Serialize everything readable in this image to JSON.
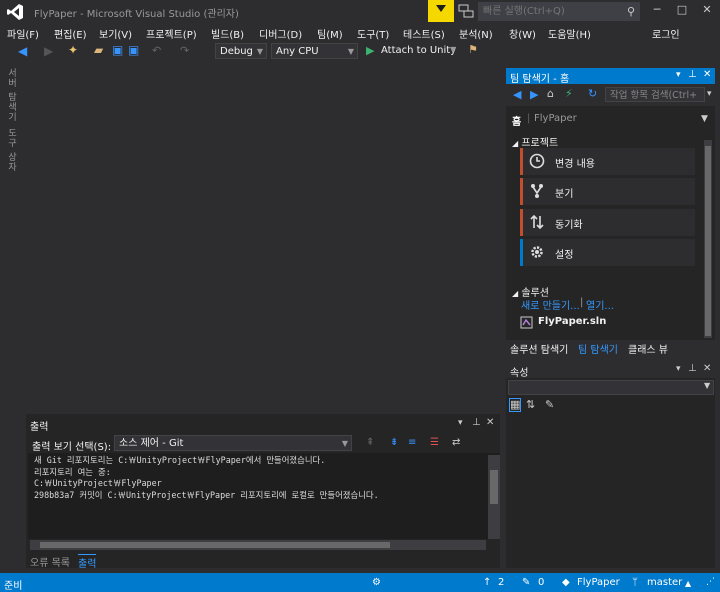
{
  "title": "FlyPaper - Microsoft Visual Studio (관리자)",
  "quick_launch": {
    "placeholder": "빠른 실행(Ctrl+Q)"
  },
  "menu": [
    "파일(F)",
    "편집(E)",
    "보기(V)",
    "프로젝트(P)",
    "빌드(B)",
    "디버그(D)",
    "팀(M)",
    "도구(T)",
    "테스트(S)",
    "분석(N)",
    "창(W)",
    "도움말(H)"
  ],
  "login": "로그인",
  "toolbar": {
    "config": "Debug",
    "platform": "Any CPU",
    "run": "Attach to Unity"
  },
  "left_tabs": [
    "서버 탐색기",
    "도구 상자"
  ],
  "team": {
    "title": "팀 탐색기 - 홈",
    "search_placeholder": "작업 항목 검색(Ctrl+",
    "home": "홈",
    "home_sub": "FlyPaper",
    "project_header": "프로젝트",
    "tiles": [
      {
        "label": "변경 내용",
        "icon": "clock-icon"
      },
      {
        "label": "분기",
        "icon": "branch-icon"
      },
      {
        "label": "동기화",
        "icon": "sync-icon"
      },
      {
        "label": "설정",
        "icon": "gear-icon"
      }
    ],
    "solution_header": "솔루션",
    "new_link": "새로 만들기...",
    "sep": "|",
    "open_link": "열기...",
    "solution_file": "FlyPaper.sln"
  },
  "right_tabs": [
    "솔루션 탐색기",
    "팀 탐색기",
    "클래스 뷰"
  ],
  "properties": {
    "title": "속성"
  },
  "output": {
    "title": "출력",
    "source_label": "출력 보기 선택(S):",
    "source_value": "소스 제어 - Git",
    "lines": [
      "새 Git 리포지토리는 C:￦UnityProject￦FlyPaper에서 만들어졌습니다.",
      "리포지토리 여는 중:",
      "C:￦UnityProject￦FlyPaper",
      "298b83a7 커밋이 C:￦UnityProject￦FlyPaper 리포지토리에 로컬로 만들어졌습니다."
    ]
  },
  "bottom_tabs": [
    "오류 목록",
    "출력"
  ],
  "status": {
    "ready": "준비",
    "up": "2",
    "pencil": "0",
    "repo": "FlyPaper",
    "branch": "master"
  },
  "colors": {
    "accent": "#007acc",
    "flag": "#f5d800",
    "tile_orange": "#c14f2e"
  }
}
